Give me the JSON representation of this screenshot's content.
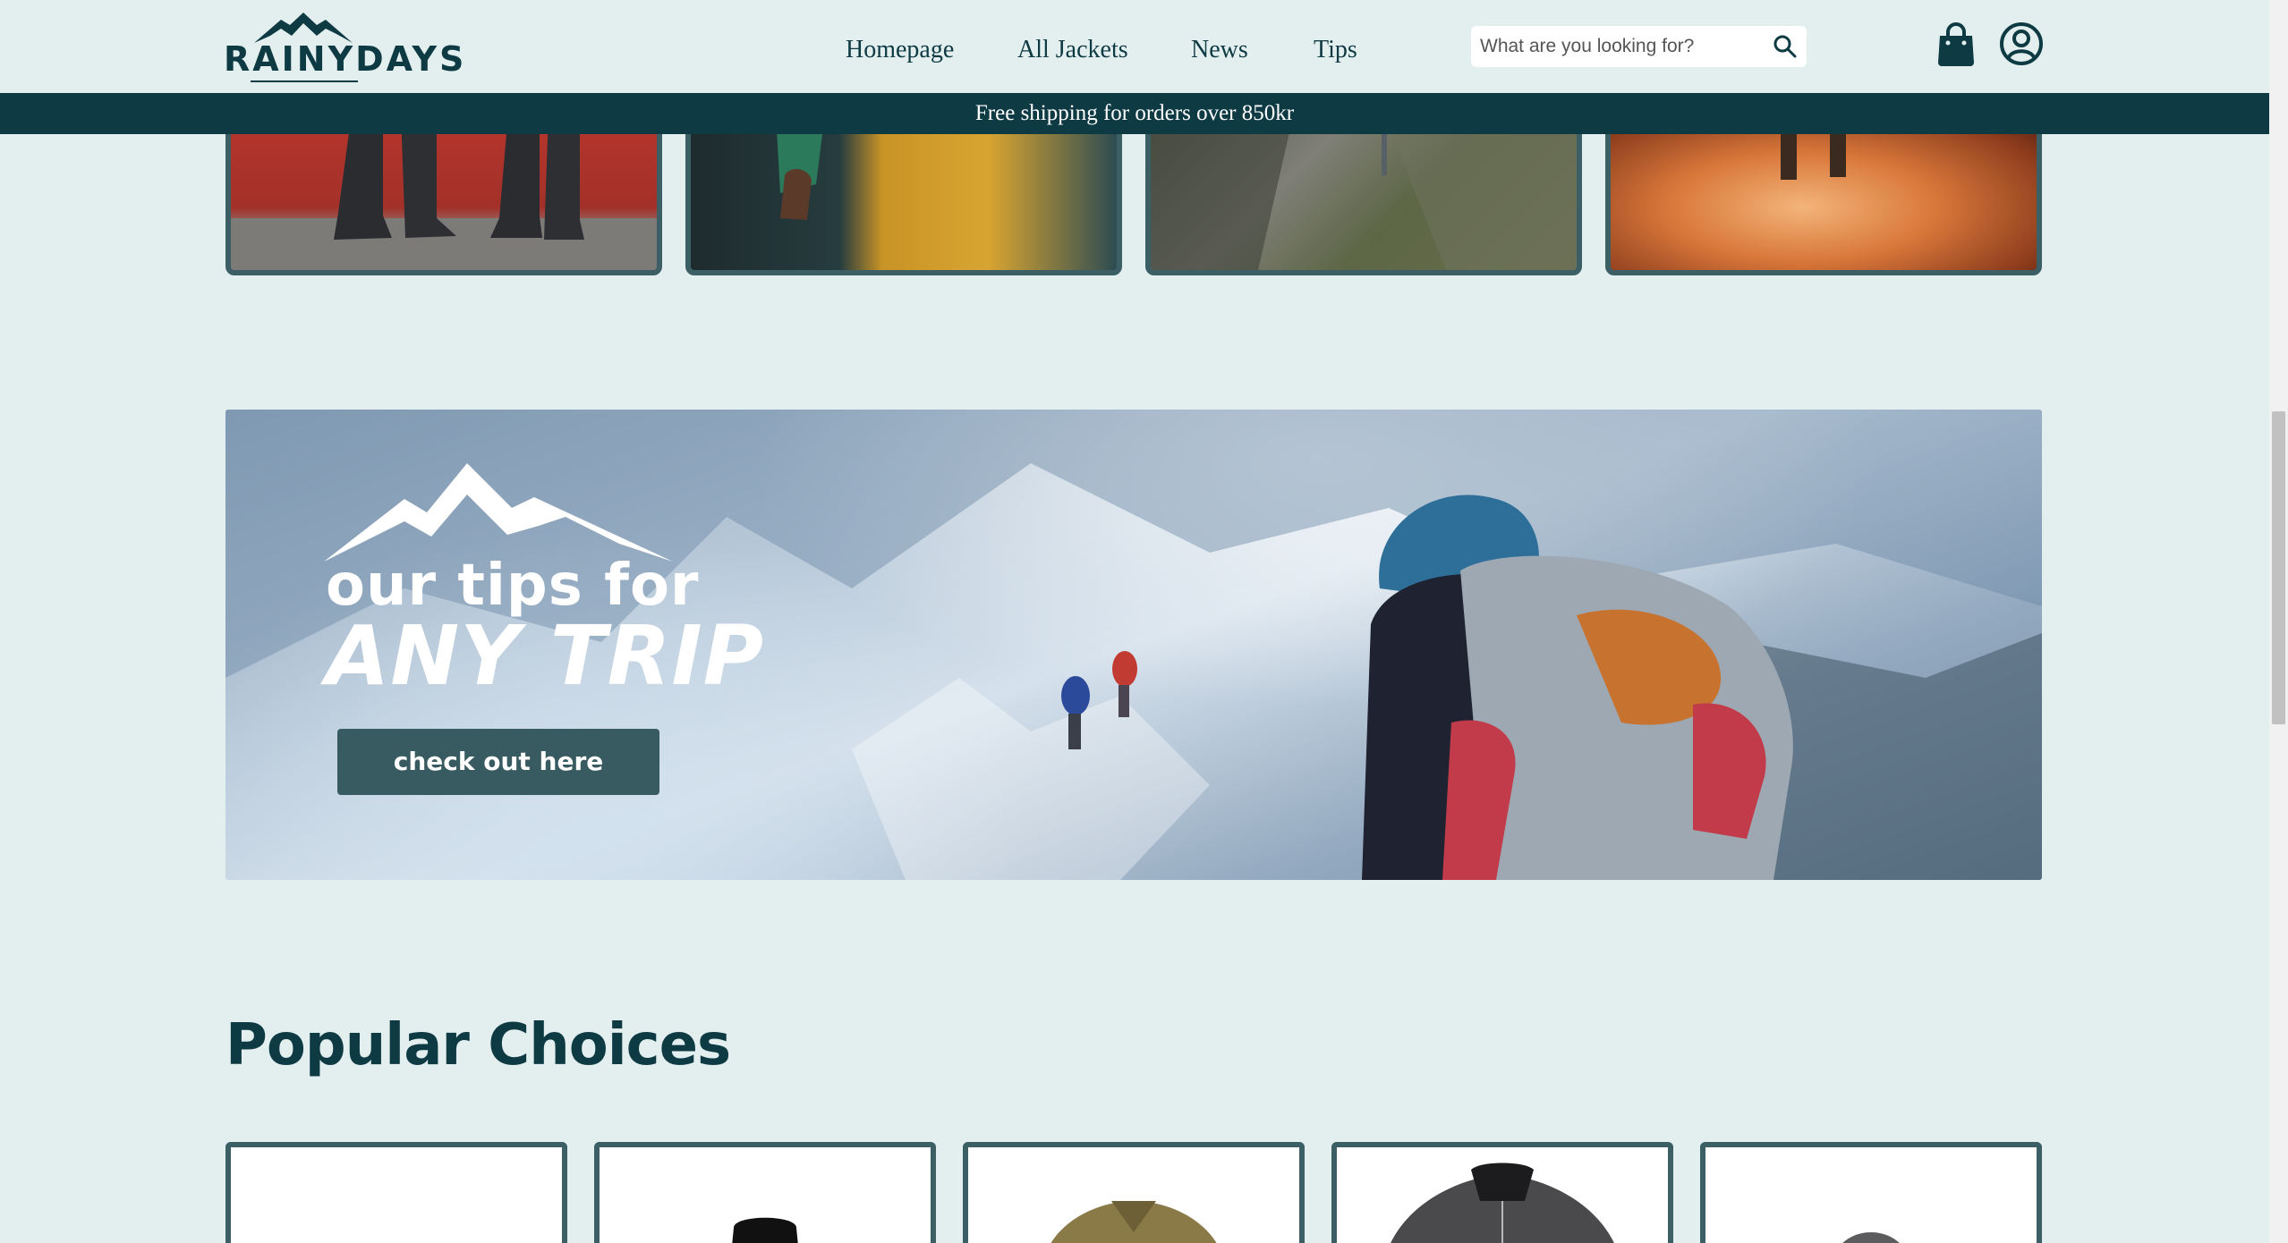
{
  "header": {
    "logo_text": "RAINYDAYS",
    "nav": [
      {
        "label": "Homepage"
      },
      {
        "label": "All Jackets"
      },
      {
        "label": "News"
      },
      {
        "label": "Tips"
      }
    ],
    "search_placeholder": "What are you looking for?",
    "icons": [
      "search-icon",
      "shopping-bag-icon",
      "account-icon"
    ]
  },
  "shipping_banner": "Free shipping for orders over 850kr",
  "tips_banner": {
    "line1": "our tips for",
    "line2": "ANY TRIP",
    "button_label": "check out here"
  },
  "popular": {
    "title": "Popular Choices"
  },
  "colors": {
    "background": "#e3efee",
    "primary_dark": "#0e3a44",
    "card_border": "#3c5f66",
    "button": "#385b62"
  }
}
